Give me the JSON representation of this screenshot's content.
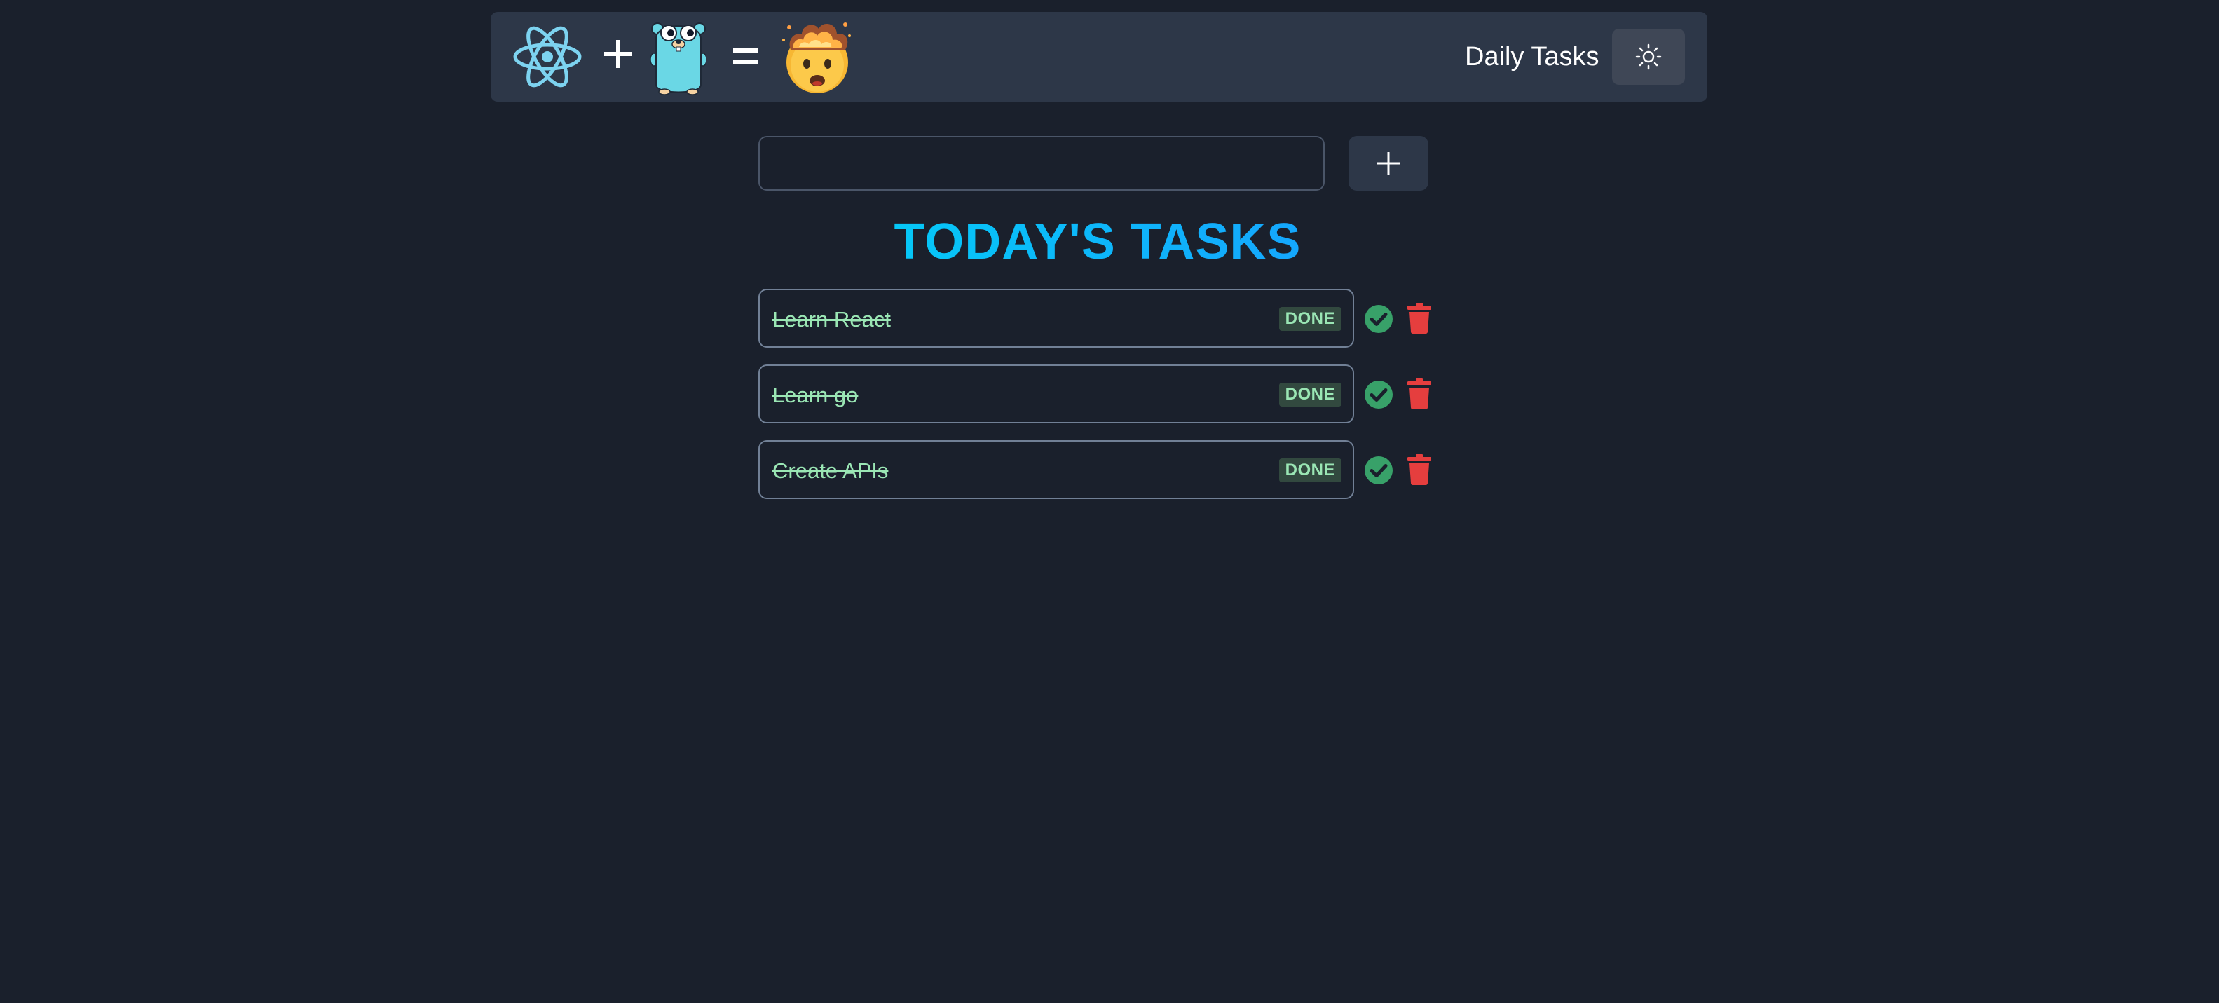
{
  "navbar": {
    "logos": [
      {
        "icon": "react-atom-icon"
      },
      {
        "icon": "plus-icon"
      },
      {
        "icon": "go-gopher-icon"
      },
      {
        "icon": "equals-icon"
      },
      {
        "icon": "mind-blown-emoji-icon"
      }
    ],
    "title": "Daily Tasks",
    "theme_toggle_icon": "sun-icon"
  },
  "form": {
    "input_value": "",
    "input_placeholder": "",
    "add_button_icon": "plus-icon"
  },
  "heading": "TODAY'S TASKS",
  "tasks": [
    {
      "body": "Learn React",
      "status": "DONE",
      "completed": true
    },
    {
      "body": "Learn go",
      "status": "DONE",
      "completed": true
    },
    {
      "body": "Create APIs",
      "status": "DONE",
      "completed": true
    }
  ],
  "colors": {
    "background": "#1a202c",
    "navbar": "#2d3748",
    "heading_gradient_start": "#00d2f5",
    "heading_gradient_end": "#1a9cff",
    "done_text": "#9ae6b4",
    "done_badge_bg": "#32493f",
    "check_icon": "#38a169",
    "trash_icon": "#e53e3e"
  }
}
